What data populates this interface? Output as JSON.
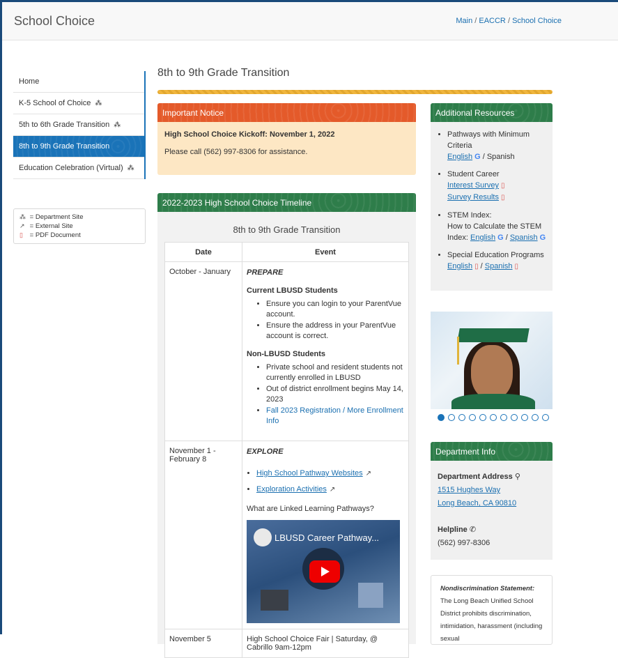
{
  "header": {
    "title": "School Choice",
    "breadcrumb": {
      "main": "Main",
      "sep1": " / ",
      "eaccr": "EACCR",
      "sep2": " / ",
      "current": "School Choice"
    }
  },
  "sidebar": {
    "items": [
      {
        "label": "Home",
        "dept": false
      },
      {
        "label": "K-5 School of Choice",
        "dept": true
      },
      {
        "label": "5th to 6th Grade Transition",
        "dept": true
      },
      {
        "label": "8th to 9th Grade Transition",
        "dept": false,
        "active": true
      },
      {
        "label": "Education Celebration (Virtual)",
        "dept": true
      }
    ],
    "legend": {
      "dept": "= Department Site",
      "external": "= External Site",
      "pdf": "= PDF Document"
    }
  },
  "main": {
    "title": "8th to 9th Grade Transition",
    "notice": {
      "heading": "Important Notice",
      "strong": "High School Choice Kickoff:  November 1, 2022",
      "text": "Please call (562) 997-8306 for assistance."
    },
    "timeline": {
      "heading": "2022-2023 High School Choice Timeline",
      "subtitle": "8th to 9th Grade Transition",
      "col_date": "Date",
      "col_event": "Event",
      "row1": {
        "date": "October - January",
        "heading": "PREPARE",
        "current_title": "Current LBUSD Students",
        "current_items": [
          "Ensure you can login to your ParentVue account.",
          "Ensure the address in your ParentVue account is correct."
        ],
        "non_title": "Non-LBUSD Students",
        "non_items": [
          "Private school and resident students not currently enrolled in LBUSD",
          "Out of district enrollment begins May 14, 2023"
        ],
        "link": "Fall 2023 Registration / More Enrollment Info"
      },
      "row2": {
        "date": "November 1 - February 8",
        "heading": "EXPLORE",
        "link1": "High School Pathway Websites",
        "link2": "Exploration Activities",
        "question": "What are Linked Learning Pathways?",
        "video_title": "LBUSD Career Pathway..."
      },
      "row3": {
        "date": "November 5",
        "text": "High School Choice Fair | Saturday, @ Cabrillo 9am-12pm"
      }
    }
  },
  "resources": {
    "heading": "Additional Resources",
    "item1": {
      "title": "Pathways with Minimum Criteria",
      "english": "English",
      "sep": " / ",
      "spanish": "Spanish"
    },
    "item2": {
      "title": "Student Career",
      "link1": "Interest Survey",
      "link2": "Survey Results"
    },
    "item3": {
      "title": "STEM Index:",
      "line2": "How to Calculate the STEM",
      "prefix": "Index:",
      "english": "English",
      "sep": " / ",
      "spanish": "Spanish"
    },
    "item4": {
      "title": "Special Education Programs",
      "english": "English",
      "sep": " / ",
      "spanish": "Spanish"
    }
  },
  "carousel": {
    "count": 11,
    "active": 0
  },
  "department": {
    "heading": "Department Info",
    "address_label": "Department Address",
    "address1": "1515 Hughes Way",
    "address2": "Long Beach, CA 90810",
    "helpline_label": "Helpline",
    "phone": "(562) 997-8306"
  },
  "nondiscrimination": {
    "label": "Nondiscrimination Statement:",
    "text": " The Long Beach Unified School District prohibits discrimination, intimidation, harassment (including sexual"
  },
  "colors": {
    "brand_blue": "#1a73b8",
    "notice_orange": "#e45a2a",
    "panel_green": "#2e7d4a",
    "gold": "#f0b53c"
  },
  "icons": {
    "dept": "sitemap-icon",
    "external": "external-link-icon",
    "pdf": "pdf-icon",
    "google": "google-icon",
    "map": "map-marker-icon",
    "phone": "phone-icon"
  }
}
